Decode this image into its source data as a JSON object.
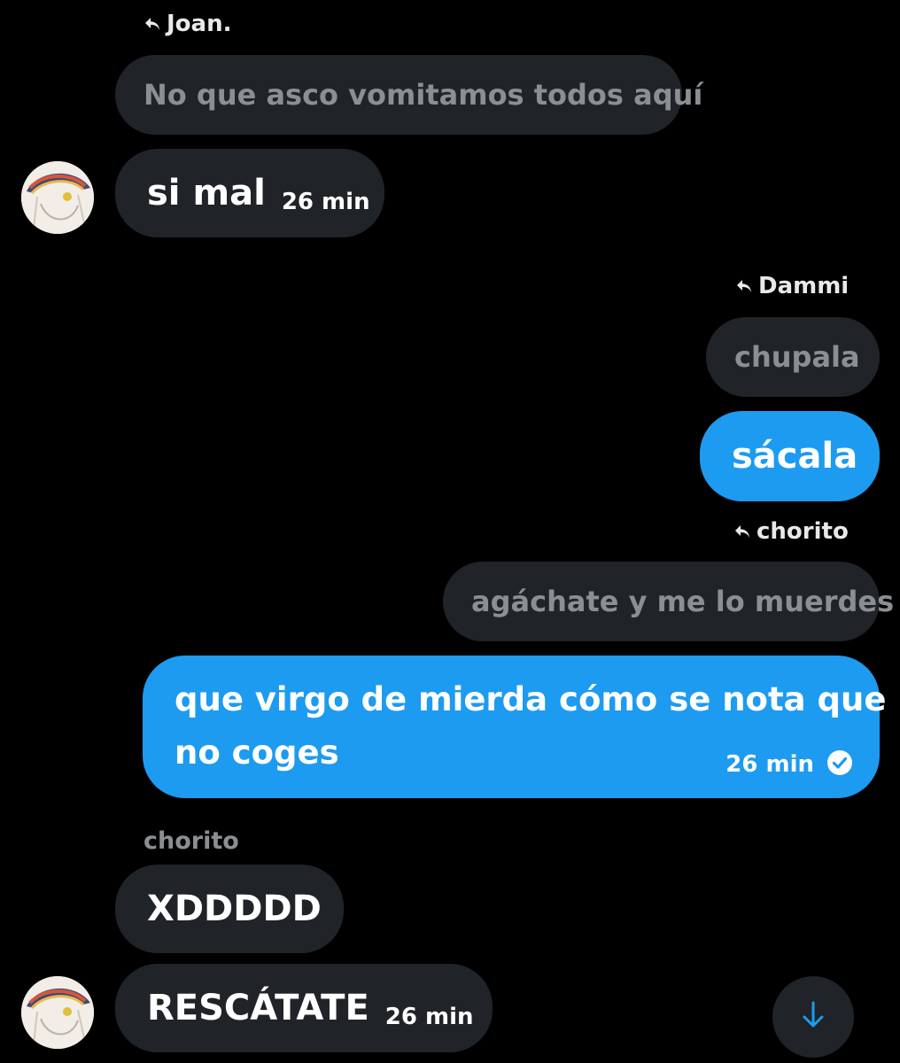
{
  "messages": [
    {
      "reply_to": "Joan.",
      "quoted": "No que asco vomitamos todos aquí",
      "text": "si mal",
      "time": "26 min"
    },
    {
      "reply_to": "Dammi",
      "quoted": "chupala",
      "text": "sácala"
    },
    {
      "reply_to": "chorito",
      "quoted": "agáchate y me lo muerdes",
      "text_line1": "que virgo de mierda cómo se nota que",
      "text_line2": "no coges",
      "time": "26 min"
    },
    {
      "sender": "chorito",
      "text": "XDDDDD"
    },
    {
      "text": "RESCÁTATE",
      "time": "26 min"
    }
  ],
  "colors": {
    "background": "#000000",
    "incoming_bubble": "#202327",
    "outgoing_bubble": "#1d9bf0",
    "muted_text": "#8b8f94"
  },
  "icons": {
    "reply": "reply-arrow-icon",
    "read_receipt": "check-circle-icon",
    "scroll_down": "arrow-down-icon"
  }
}
